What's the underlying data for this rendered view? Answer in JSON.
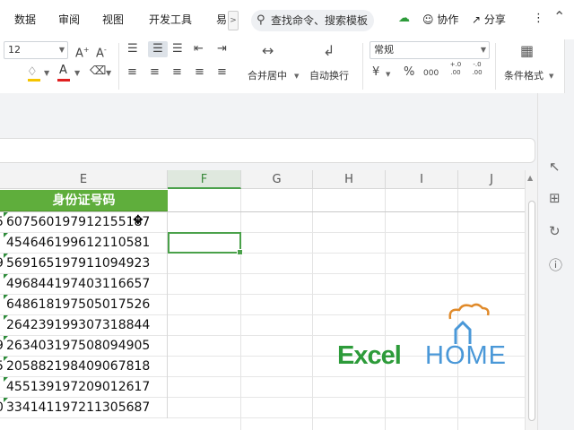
{
  "menu": {
    "items": [
      "数据",
      "审阅",
      "视图",
      "开发工具",
      "易"
    ],
    "more": ">",
    "search_placeholder": "查找命令、搜索模板",
    "collab": "协作",
    "share": "分享",
    "more_dots": "⋮"
  },
  "ribbon": {
    "font_size": "12",
    "merge_center": "合并居中",
    "wrap_text": "自动换行",
    "number_format": "常规",
    "conditional_format": "条件格式",
    "currency_symbol": "¥",
    "percent_symbol": "%",
    "thousands": "000",
    "inc_decimal": "+.0 .00",
    "dec_decimal": "-.0 .00"
  },
  "grid": {
    "columns": [
      "E",
      "F",
      "G",
      "H",
      "I",
      "J"
    ],
    "selected_column": "F",
    "header_cell": "身份证号码",
    "id_numbers": [
      "607560197912155187",
      "454646199612110581",
      "569165197911094923",
      "496844197403116657",
      "648618197505017526",
      "264239199307318844",
      "263403197508094905",
      "205882198409067818",
      "455139197209012617",
      "334141197211305687"
    ],
    "left_edge_chars": [
      "5",
      "",
      "9",
      "",
      "",
      "",
      "9",
      "5",
      "",
      "0"
    ]
  },
  "watermark": {
    "excel": "Excel",
    "home": "HOME"
  },
  "colors": {
    "accent_green": "#4aa14a",
    "header_fill": "#5fae3c",
    "watermark_green": "#2d9b3a",
    "watermark_blue": "#4a98d8"
  }
}
